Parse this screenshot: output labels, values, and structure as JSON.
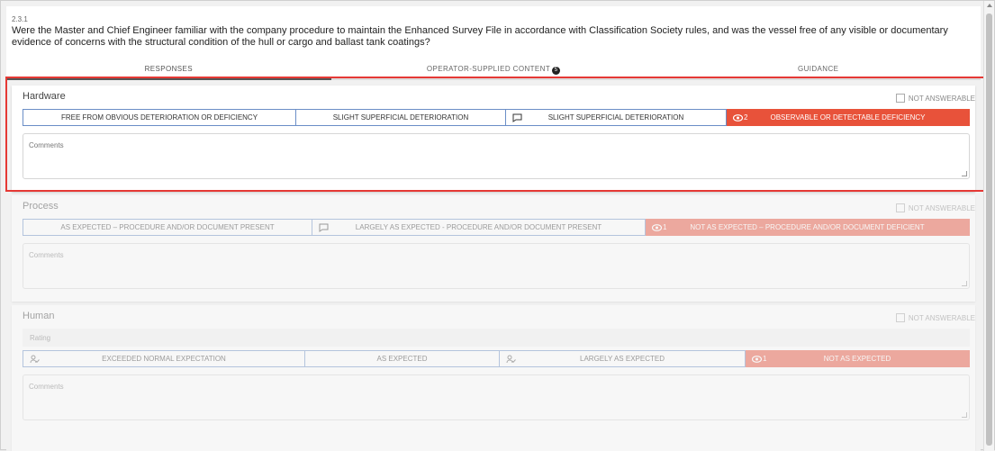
{
  "question": {
    "number": "2.3.1",
    "text": "Were the Master and Chief Engineer familiar with the company procedure to maintain the Enhanced Survey File in accordance with Classification Society rules, and was the vessel free of any visible or documentary evidence of concerns with the structural condition of the hull or cargo and ballast tank coatings?"
  },
  "tabs": [
    {
      "label": "RESPONSES"
    },
    {
      "label": "OPERATOR-SUPPLIED CONTENT",
      "badge": "5"
    },
    {
      "label": "GUIDANCE"
    }
  ],
  "not_answerable_label": "NOT ANSWERABLE",
  "comments_placeholder": "Comments",
  "sections": {
    "hardware": {
      "title": "Hardware",
      "options": [
        {
          "label": "FREE FROM OBVIOUS DETERIORATION OR DEFICIENCY"
        },
        {
          "label": "SLIGHT SUPERFICIAL DETERIORATION"
        },
        {
          "label": "SLIGHT SUPERFICIAL DETERIORATION",
          "icon": "comment-icon"
        },
        {
          "label": "OBSERVABLE OR DETECTABLE DEFICIENCY",
          "icon": "eye-icon",
          "count": "2",
          "selected": true
        }
      ]
    },
    "process": {
      "title": "Process",
      "options": [
        {
          "label": "AS EXPECTED – PROCEDURE AND/OR DOCUMENT PRESENT"
        },
        {
          "label": "LARGELY AS EXPECTED - PROCEDURE AND/OR DOCUMENT PRESENT",
          "icon": "comment-icon"
        },
        {
          "label": "NOT AS EXPECTED – PROCEDURE AND/OR DOCUMENT DEFICIENT",
          "icon": "eye-icon",
          "count": "1",
          "selected": true
        }
      ]
    },
    "human": {
      "title": "Human",
      "rating_label": "Rating",
      "options": [
        {
          "label": "EXCEEDED NORMAL EXPECTATION",
          "icon": "person-icon"
        },
        {
          "label": "AS EXPECTED"
        },
        {
          "label": "LARGELY AS EXPECTED",
          "icon": "person-icon"
        },
        {
          "label": "NOT AS EXPECTED",
          "icon": "eye-icon",
          "count": "1",
          "selected": true
        }
      ]
    }
  },
  "colors": {
    "selected": "#e8523a",
    "option_border": "#6b8ec7",
    "highlight": "#e53935"
  }
}
